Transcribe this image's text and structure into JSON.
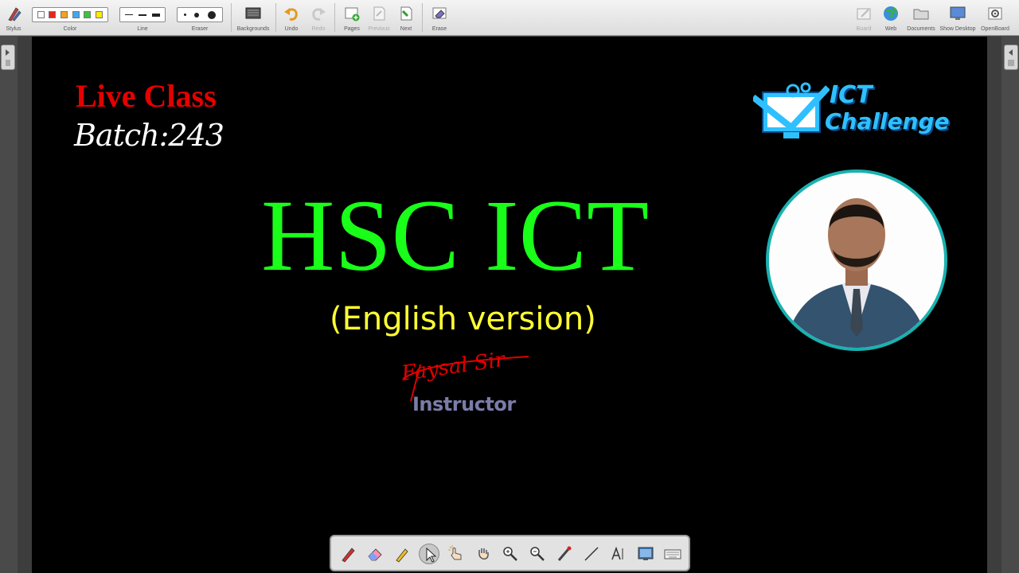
{
  "toolbar": {
    "stylus": "Stylus",
    "color": "Color",
    "line": "Line",
    "eraser": "Eraser",
    "backgrounds": "Backgrounds",
    "undo": "Undo",
    "redo": "Redo",
    "pages": "Pages",
    "previous": "Previous",
    "next": "Next",
    "erase": "Erase",
    "board": "Board",
    "web": "Web",
    "documents": "Documents",
    "show_desktop": "Show Desktop",
    "openboard": "OpenBoard",
    "colors": [
      "#ffffff",
      "#e8261f",
      "#f4a020",
      "#40a8f0",
      "#3ec23e",
      "#ffea00"
    ]
  },
  "slide": {
    "live_class": "Live Class",
    "batch": "Batch:243",
    "title": "HSC ICT",
    "version": "(English version)",
    "signature": "Faysal Sir",
    "role": "Instructor",
    "logo_line1": "ICT",
    "logo_line2": "Challenge"
  },
  "colors": {
    "title_green": "#19ff19",
    "live_red": "#e60000",
    "version_yellow": "#ffff33",
    "photo_ring": "#19b2b0"
  },
  "bottom_tools": [
    "pen-icon",
    "eraser-icon",
    "marker-icon",
    "selector-icon",
    "interact-icon",
    "hand-icon",
    "zoom-in-icon",
    "zoom-out-icon",
    "laser-icon",
    "line-icon",
    "text-icon",
    "capture-icon",
    "keyboard-icon"
  ]
}
